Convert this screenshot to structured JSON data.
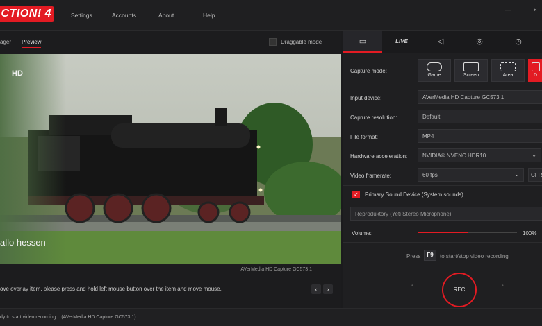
{
  "app": {
    "logo_text": "CTION! 4",
    "brand_color": "#e31b23"
  },
  "menu": {
    "items": [
      "Settings",
      "Accounts",
      "About",
      "Help"
    ]
  },
  "window": {
    "minimize": "—",
    "close": "×"
  },
  "left": {
    "tabs": [
      "ager",
      "Preview"
    ],
    "draggable_label": "Draggable mode",
    "watermark_top": "HD",
    "watermark_bottom": "allo hessen",
    "caption": "AVerMedia HD Capture GC573 1",
    "hint": "ove overlay item, please press and hold left mouse button over the item and move mouse.",
    "prev": "‹",
    "next": "›"
  },
  "right": {
    "capture_mode_label": "Capture mode:",
    "modes": [
      {
        "label": "Game",
        "icon": "gamepad-icon"
      },
      {
        "label": "Screen",
        "icon": "screen-icon"
      },
      {
        "label": "Area",
        "icon": "area-icon"
      },
      {
        "label": "D",
        "icon": "device-icon"
      }
    ],
    "fields": [
      {
        "label": "Input device:",
        "value": "AVerMedia HD Capture GC573 1"
      },
      {
        "label": "Capture resolution:",
        "value": "Default"
      },
      {
        "label": "File format:",
        "value": "MP4"
      },
      {
        "label": "Hardware acceleration:",
        "value": "NVIDIA® NVENC HDR10"
      },
      {
        "label": "Video framerate:",
        "value": "60 fps",
        "extra": "CFR"
      }
    ],
    "sound_device": "Primary Sound Device (System sounds)",
    "microphone": "Reproduktory (Yeti Stereo Microphone)",
    "volume_label": "Volume:",
    "volume_value": "100%",
    "volume_fraction": 0.5,
    "press_label": "Press",
    "key": "F9",
    "record_hint": "to start/stop video recording",
    "rec_label": "REC"
  },
  "status": "dy to start video recording... (AVerMedia HD Capture GC573 1)"
}
